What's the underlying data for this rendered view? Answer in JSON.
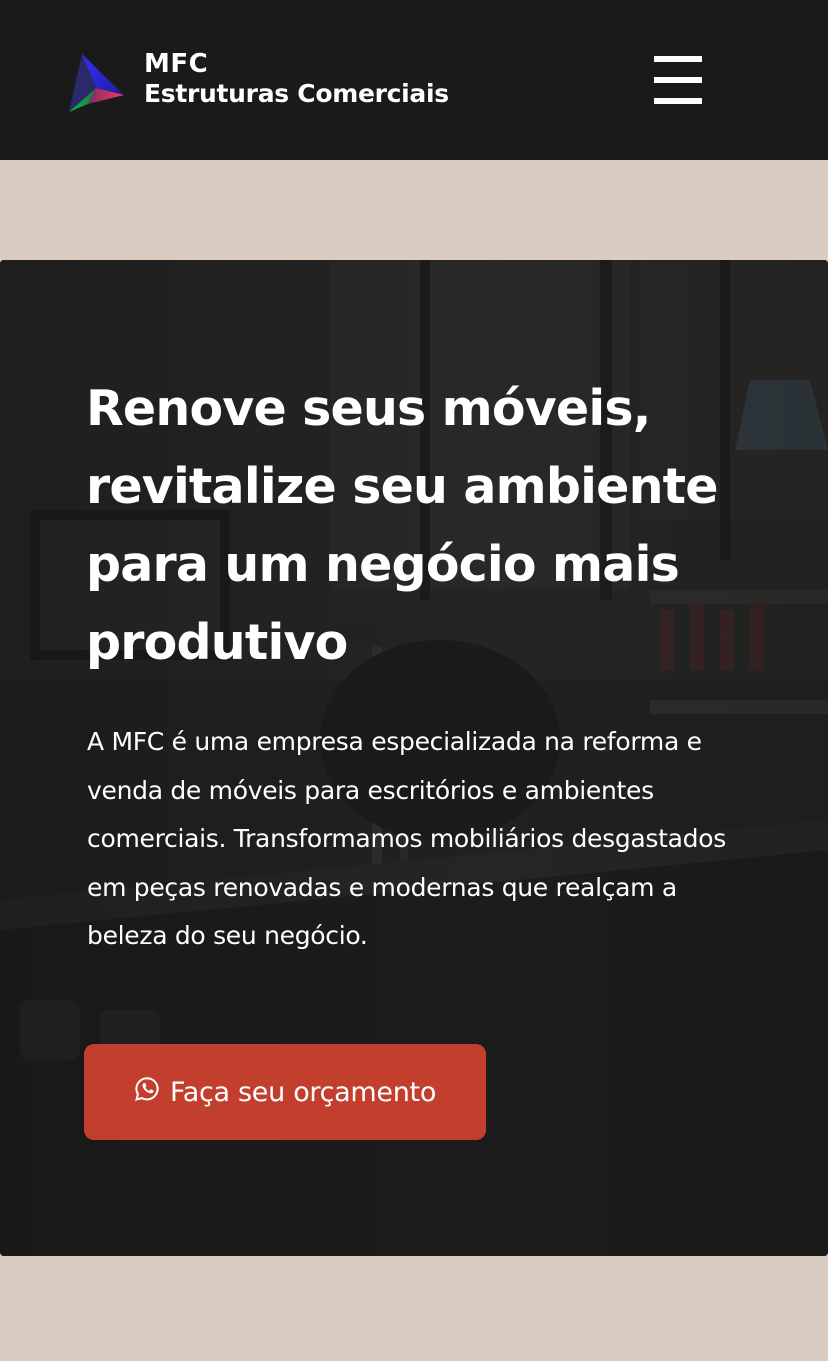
{
  "header": {
    "brand_line1": "MFC",
    "brand_line2": "Estruturas Comerciais",
    "menu_icon": "hamburger-menu-icon"
  },
  "hero": {
    "title": "Renove seus móveis, revitalize seu ambiente para um negócio mais produtivo",
    "description": "A MFC é uma empresa especializada na reforma e venda de móveis para escritórios e ambientes comerciais. Transformamos mobiliários desgastados em peças renovadas e modernas que realçam a beleza do seu negócio.",
    "cta_label": "Faça seu orçamento",
    "cta_icon": "whatsapp-icon"
  },
  "colors": {
    "header_bg": "#1a1a1a",
    "page_bg": "#dbccc1",
    "cta_bg": "#c23e2d",
    "text": "#ffffff"
  }
}
